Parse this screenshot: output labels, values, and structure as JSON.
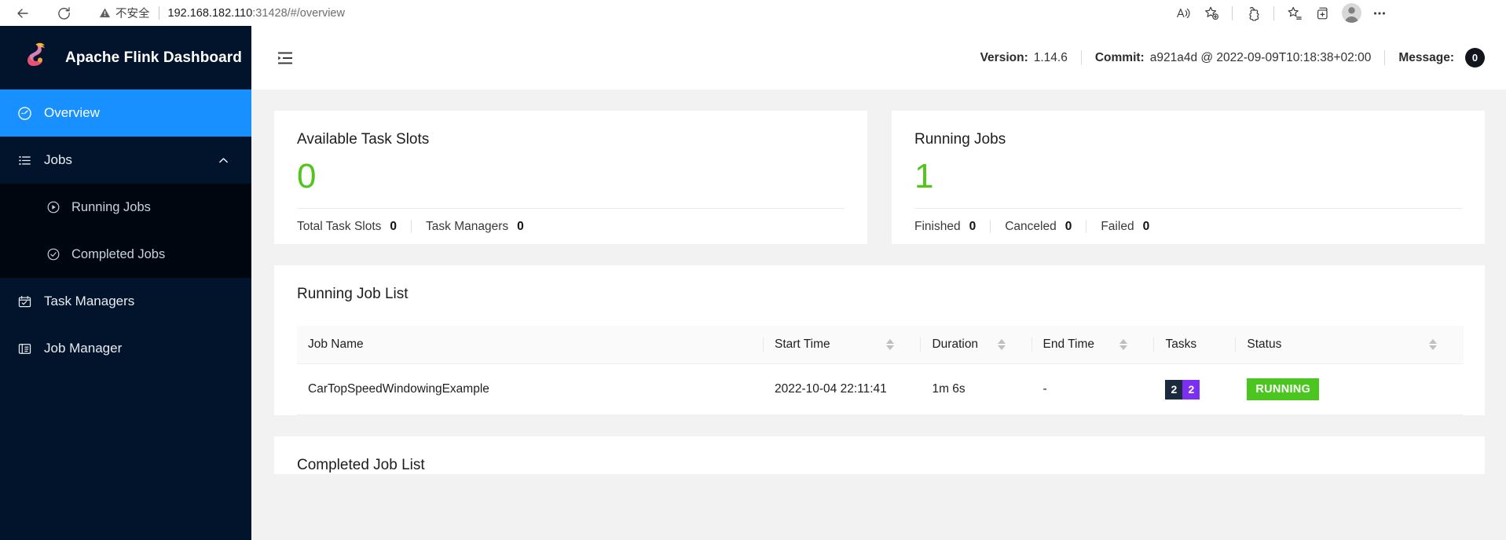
{
  "browser": {
    "back_icon": "back-arrow-icon",
    "reload_icon": "reload-icon",
    "security_label": "不安全",
    "url_host": "192.168.182.110",
    "url_rest": ":31428/#/overview",
    "toolbar_icons": [
      "read-aloud-icon",
      "add-favorite-icon",
      "extensions-icon",
      "favorites-icon",
      "collections-icon",
      "profile-avatar",
      "settings-more-icon"
    ]
  },
  "sidebar": {
    "brand": "Apache Flink Dashboard",
    "logo": "flink-squirrel-logo",
    "items": [
      {
        "label": "Overview",
        "icon": "dashboard-icon",
        "active": true
      },
      {
        "label": "Jobs",
        "icon": "list-icon",
        "active": false,
        "expanded": true
      },
      {
        "label": "Task Managers",
        "icon": "task-managers-icon",
        "active": false
      },
      {
        "label": "Job Manager",
        "icon": "job-manager-icon",
        "active": false
      }
    ],
    "subitems": [
      {
        "label": "Running Jobs",
        "icon": "play-circle-icon"
      },
      {
        "label": "Completed Jobs",
        "icon": "check-circle-icon"
      }
    ]
  },
  "topbar": {
    "fold_icon": "menu-fold-icon",
    "version_label": "Version:",
    "version_value": "1.14.6",
    "commit_label": "Commit:",
    "commit_value": "a921a4d @ 2022-09-09T10:18:38+02:00",
    "message_label": "Message:",
    "message_count": "0"
  },
  "cards": [
    {
      "title": "Available Task Slots",
      "value": "0",
      "value_color": "#52c41a",
      "footer": [
        {
          "label": "Total Task Slots",
          "value": "0"
        },
        {
          "label": "Task Managers",
          "value": "0"
        }
      ]
    },
    {
      "title": "Running Jobs",
      "value": "1",
      "value_color": "#52c41a",
      "footer": [
        {
          "label": "Finished",
          "value": "0"
        },
        {
          "label": "Canceled",
          "value": "0"
        },
        {
          "label": "Failed",
          "value": "0"
        }
      ]
    }
  ],
  "running_job_list": {
    "title": "Running Job List",
    "columns": [
      {
        "label": "Job Name",
        "sortable": false
      },
      {
        "label": "Start Time",
        "sortable": true
      },
      {
        "label": "Duration",
        "sortable": true
      },
      {
        "label": "End Time",
        "sortable": true
      },
      {
        "label": "Tasks",
        "sortable": false
      },
      {
        "label": "Status",
        "sortable": true
      }
    ],
    "rows": [
      {
        "job_name": "CarTopSpeedWindowingExample",
        "start_time": "2022-10-04 22:11:41",
        "duration": "1m 6s",
        "end_time": "-",
        "tasks": [
          {
            "count": "2",
            "color": "#1c2a3e"
          },
          {
            "count": "2",
            "color": "#7b2ff2"
          }
        ],
        "status": "RUNNING",
        "status_color": "#4bc621"
      }
    ]
  },
  "completed_job_list": {
    "title": "Completed Job List"
  }
}
